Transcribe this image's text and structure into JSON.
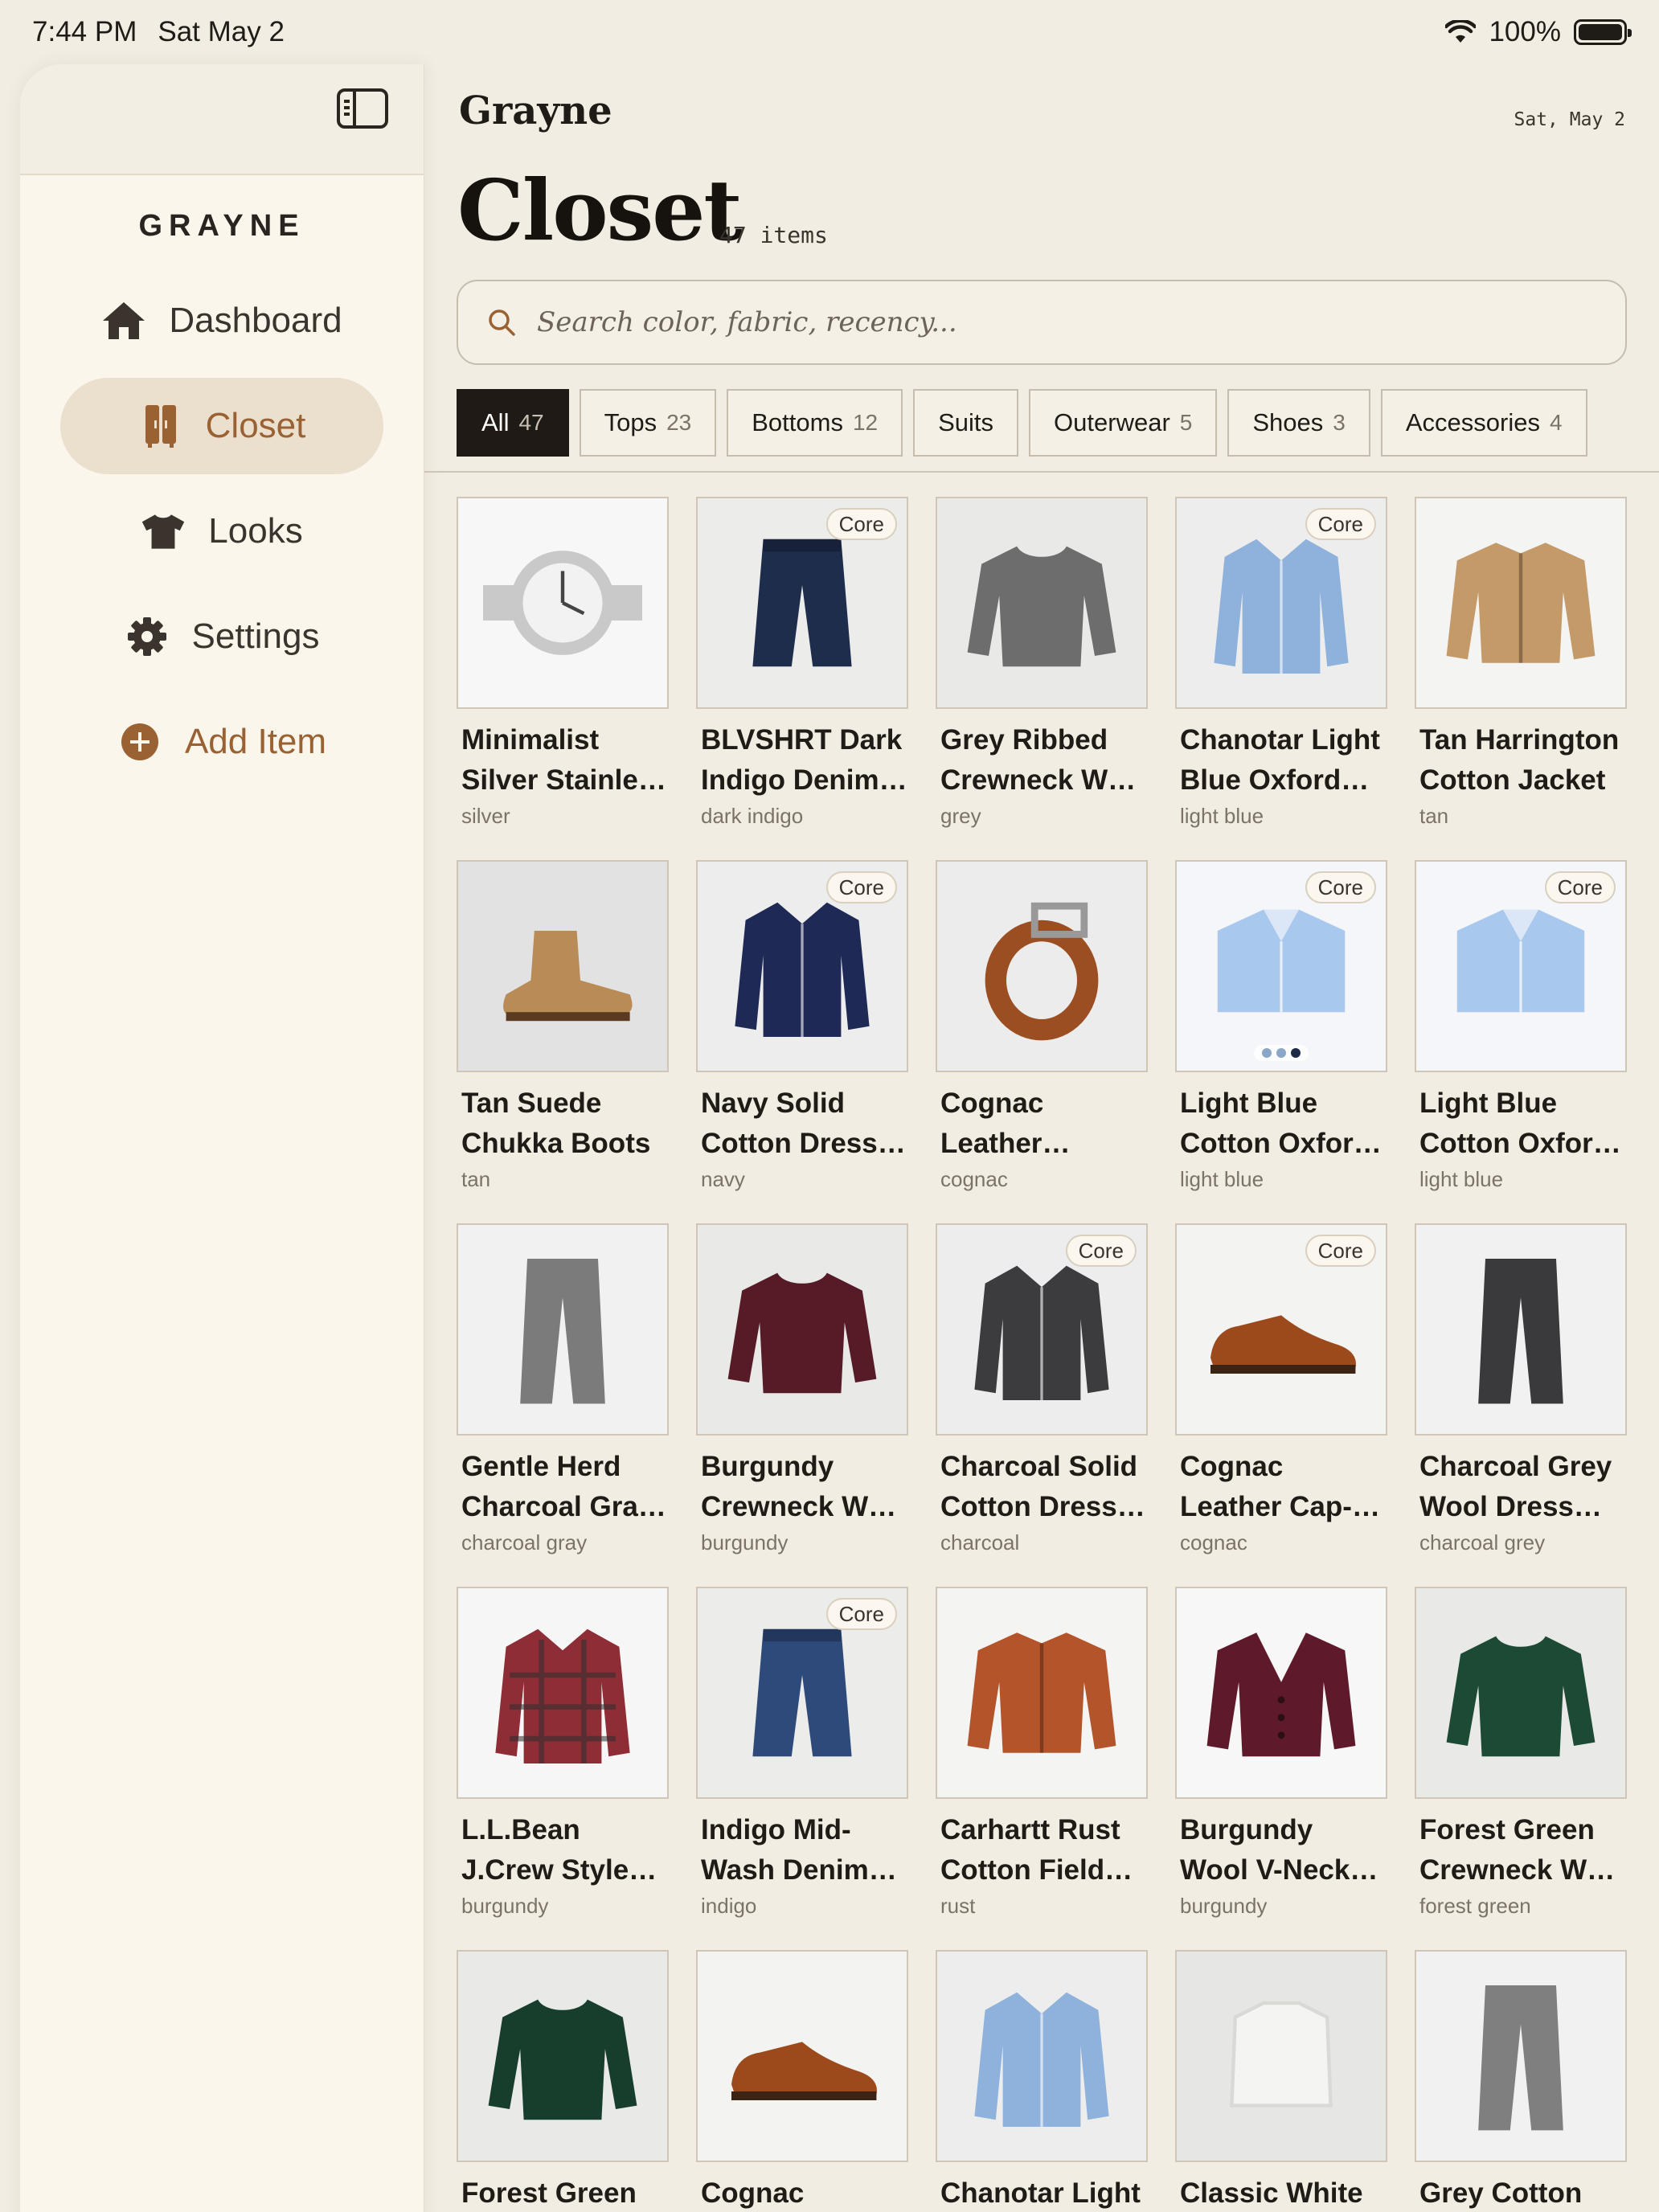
{
  "status": {
    "time": "7:44 PM",
    "date": "Sat May 2",
    "battery": "100%"
  },
  "sidebar": {
    "brand": "GRAYNE",
    "items": [
      {
        "label": "Dashboard",
        "icon": "home-icon"
      },
      {
        "label": "Closet",
        "icon": "closet-icon",
        "active": true
      },
      {
        "label": "Looks",
        "icon": "tshirt-icon"
      },
      {
        "label": "Settings",
        "icon": "gear-icon"
      },
      {
        "label": "Add Item",
        "icon": "plus-circle-icon"
      }
    ]
  },
  "header": {
    "app_name": "Grayne",
    "date": "Sat, May 2",
    "title": "Closet",
    "count": "47 items"
  },
  "search": {
    "placeholder": "Search color, fabric, recency..."
  },
  "filters": [
    {
      "label": "All",
      "count": "47",
      "active": true
    },
    {
      "label": "Tops",
      "count": "23"
    },
    {
      "label": "Bottoms",
      "count": "12"
    },
    {
      "label": "Suits",
      "count": ""
    },
    {
      "label": "Outerwear",
      "count": "5"
    },
    {
      "label": "Shoes",
      "count": "3"
    },
    {
      "label": "Accessories",
      "count": "4"
    }
  ],
  "badge_label": "Core",
  "items": [
    {
      "name": "Minimalist Silver Stainle…",
      "color": "silver",
      "core": false,
      "icon": "watch-icon",
      "swatch": "#c9c9c9"
    },
    {
      "name": "BLVSHRT Dark Indigo Denim…",
      "color": "dark indigo",
      "core": true,
      "icon": "jeans-icon",
      "swatch": "#1f2d4d"
    },
    {
      "name": "Grey Ribbed Crewneck W…",
      "color": "grey",
      "core": false,
      "icon": "sweater-icon",
      "swatch": "#6d6d6d"
    },
    {
      "name": "Chanotar Light Blue Oxford…",
      "color": "light blue",
      "core": true,
      "icon": "shirt-icon",
      "swatch": "#8fb2dc"
    },
    {
      "name": "Tan Harrington Cotton Jacket",
      "color": "tan",
      "core": false,
      "icon": "jacket-icon",
      "swatch": "#c49a68"
    },
    {
      "name": "Tan Suede Chukka Boots",
      "color": "tan",
      "core": false,
      "icon": "boot-icon",
      "swatch": "#b98b57"
    },
    {
      "name": "Navy Solid Cotton Dress…",
      "color": "navy",
      "core": true,
      "icon": "shirt-icon",
      "swatch": "#1e2a55"
    },
    {
      "name": "Cognac Leather Classic Dress…",
      "color": "cognac",
      "core": false,
      "icon": "belt-icon",
      "swatch": "#9c4e23"
    },
    {
      "name": "Light Blue Cotton Oxfor…",
      "color": "light blue",
      "core": true,
      "icon": "folded-shirt-icon",
      "swatch": "#a9c8ee",
      "dots": true
    },
    {
      "name": "Light Blue Cotton Oxfor…",
      "color": "light blue",
      "core": true,
      "icon": "folded-shirt-icon",
      "swatch": "#a9c8ee"
    },
    {
      "name": "Gentle Herd Charcoal Gra…",
      "color": "charcoal gray",
      "core": false,
      "icon": "trousers-icon",
      "swatch": "#7b7b7b"
    },
    {
      "name": "Burgundy Crewneck W…",
      "color": "burgundy",
      "core": false,
      "icon": "sweater-icon",
      "swatch": "#561b27"
    },
    {
      "name": "Charcoal Solid Cotton Dress…",
      "color": "charcoal",
      "core": true,
      "icon": "shirt-icon",
      "swatch": "#3c3c3e"
    },
    {
      "name": "Cognac Leather Cap-Toe Oxfo…",
      "color": "cognac",
      "core": true,
      "icon": "shoe-icon",
      "swatch": "#9c4a1c"
    },
    {
      "name": "Charcoal Grey Wool Dress S…",
      "color": "charcoal grey",
      "core": false,
      "icon": "trousers-icon",
      "swatch": "#3a3a3c"
    },
    {
      "name": "L.L.Bean J.Crew Style…",
      "color": "burgundy",
      "core": false,
      "icon": "flannel-icon",
      "swatch": "#8e2d36"
    },
    {
      "name": "Indigo Mid-Wash Denim…",
      "color": "indigo",
      "core": true,
      "icon": "jeans-icon",
      "swatch": "#2e4a7a"
    },
    {
      "name": "Carhartt Rust Cotton Field…",
      "color": "rust",
      "core": false,
      "icon": "jacket-icon",
      "swatch": "#b4542a"
    },
    {
      "name": "Burgundy Wool V-Neck Cardi…",
      "color": "burgundy",
      "core": false,
      "icon": "cardigan-icon",
      "swatch": "#5e1a2a"
    },
    {
      "name": "Forest Green Crewneck W…",
      "color": "forest green",
      "core": false,
      "icon": "sweater-icon",
      "swatch": "#1d4a34"
    },
    {
      "name": "Forest Green",
      "color": "",
      "core": false,
      "icon": "sweater-icon",
      "swatch": "#173e2c"
    },
    {
      "name": "Cognac Leather",
      "color": "",
      "core": false,
      "icon": "shoe-icon",
      "swatch": "#9c4a1c"
    },
    {
      "name": "Chanotar Light",
      "color": "",
      "core": false,
      "icon": "shirt-icon",
      "swatch": "#8fb2dc"
    },
    {
      "name": "Classic White",
      "color": "",
      "core": false,
      "icon": "tshirt-icon",
      "swatch": "#f4f4f2"
    },
    {
      "name": "Grey Cotton",
      "color": "",
      "core": false,
      "icon": "trousers-icon",
      "swatch": "#7f7f80"
    }
  ]
}
